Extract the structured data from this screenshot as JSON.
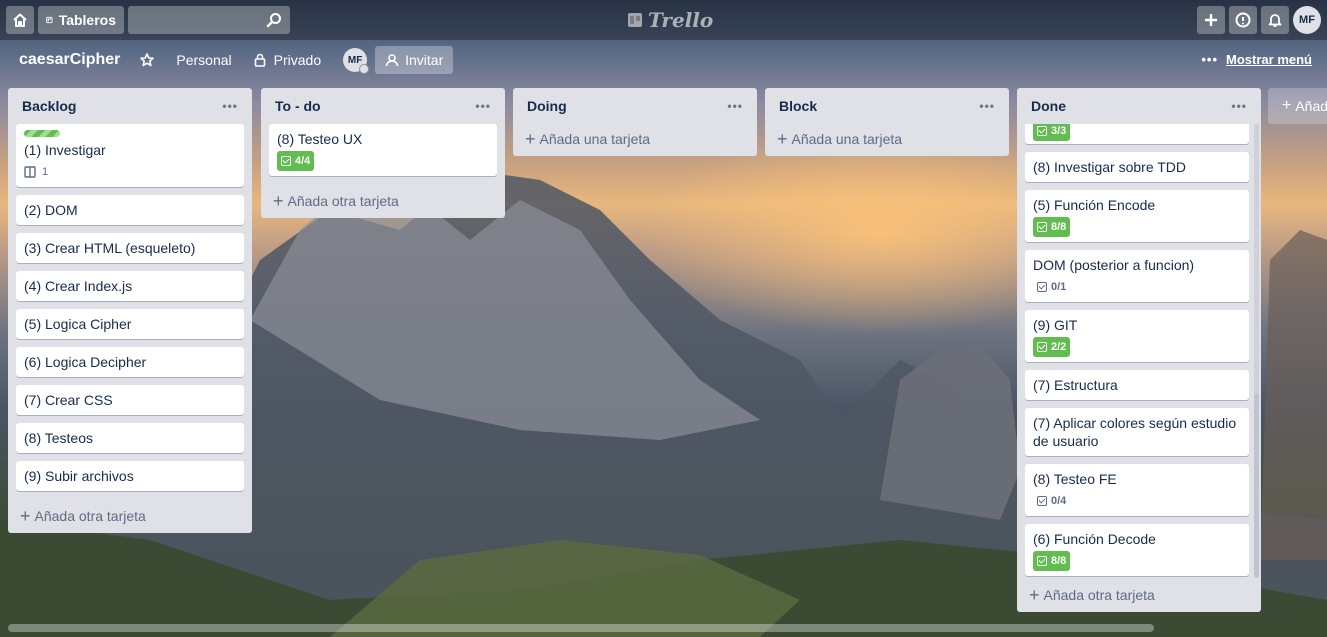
{
  "header": {
    "boards_label": "Tableros",
    "search_value": "",
    "logo_text": "Trello",
    "user_initials": "MF"
  },
  "board": {
    "title": "caesarCipher",
    "team": "Personal",
    "visibility": "Privado",
    "member_initials": "MF",
    "invite_label": "Invitar",
    "menu_label": "Mostrar menú",
    "add_list_label": "Añad"
  },
  "lists": [
    {
      "title": "Backlog",
      "cards": [
        {
          "title": "(1) Investigar",
          "label_color": "#61bd4f",
          "desc_count": "1"
        },
        {
          "title": "(2) DOM"
        },
        {
          "title": "(3) Crear HTML (esqueleto)"
        },
        {
          "title": "(4) Crear Index.js"
        },
        {
          "title": "(5) Logica Cipher"
        },
        {
          "title": "(6) Logica Decipher"
        },
        {
          "title": "(7) Crear CSS"
        },
        {
          "title": "(8) Testeos"
        },
        {
          "title": "(9) Subir archivos"
        }
      ],
      "add_label": "Añada otra tarjeta"
    },
    {
      "title": "To - do",
      "cards": [
        {
          "title": "(8) Testeo UX",
          "checklist": "4/4"
        }
      ],
      "add_label": "Añada otra tarjeta"
    },
    {
      "title": "Doing",
      "cards": [],
      "add_label": "Añada una tarjeta"
    },
    {
      "title": "Block",
      "cards": [],
      "add_label": "Añada una tarjeta"
    },
    {
      "title": "Done",
      "cards": [
        {
          "title": "",
          "checklist": "3/3"
        },
        {
          "title": "(8) Investigar sobre TDD"
        },
        {
          "title": "(5) Función Encode",
          "checklist": "8/8"
        },
        {
          "title": "DOM (posterior a funcion)",
          "checklist": "0/1"
        },
        {
          "title": "(9) GIT",
          "checklist": "2/2"
        },
        {
          "title": "(7) Estructura"
        },
        {
          "title": "(7) Aplicar colores según estudio de usuario"
        },
        {
          "title": "(8) Testeo FE",
          "checklist": "0/4"
        },
        {
          "title": "(6) Función Decode",
          "checklist": "8/8"
        }
      ],
      "add_label": "Añada otra tarjeta"
    }
  ],
  "colors": {
    "header_overlay": "rgba(0,0,0,0.32)",
    "list_bg": "#dfe1e6",
    "checklist_done": "#61bd4f",
    "text": "#172b4d",
    "muted": "#5e6c84"
  }
}
